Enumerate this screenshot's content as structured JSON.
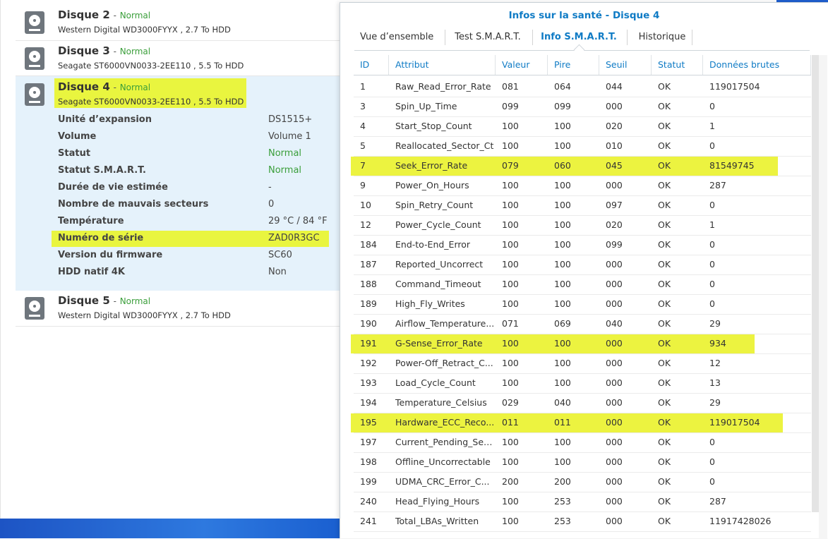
{
  "disks": [
    {
      "name": "Disque 2",
      "status": "Normal",
      "model": "Western Digital WD3000FYYX , 2.7 To HDD"
    },
    {
      "name": "Disque 3",
      "status": "Normal",
      "model": "Seagate ST6000VN0033-2EE110 , 5.5 To HDD"
    },
    {
      "name": "Disque 4",
      "status": "Normal",
      "model": "Seagate ST6000VN0033-2EE110 , 5.5 To HDD"
    },
    {
      "name": "Disque 5",
      "status": "Normal",
      "model": "Western Digital WD3000FYYX , 2.7 To HDD"
    }
  ],
  "separator": "-",
  "details": [
    {
      "label": "Unité d’expansion",
      "value": "DS1515+"
    },
    {
      "label": "Volume",
      "value": "Volume 1"
    },
    {
      "label": "Statut",
      "value": "Normal"
    },
    {
      "label": "Statut S.M.A.R.T.",
      "value": "Normal"
    },
    {
      "label": "Durée de vie estimée",
      "value": "-"
    },
    {
      "label": "Nombre de mauvais secteurs",
      "value": "0"
    },
    {
      "label": "Température",
      "value": "29 °C / 84 °F"
    },
    {
      "label": "Numéro de série",
      "value": "ZAD0R3GC"
    },
    {
      "label": "Version du firmware",
      "value": "SC60"
    },
    {
      "label": "HDD natif 4K",
      "value": "Non"
    }
  ],
  "dialog": {
    "title": "Infos sur la santé - Disque 4",
    "tabs": [
      "Vue d’ensemble",
      "Test S.M.A.R.T.",
      "Info S.M.A.R.T.",
      "Historique"
    ],
    "active_tab": "Info S.M.A.R.T."
  },
  "table": {
    "headers": [
      "ID",
      "Attribut",
      "Valeur",
      "Pire",
      "Seuil",
      "Statut",
      "Données brutes"
    ],
    "rows": [
      [
        "1",
        "Raw_Read_Error_Rate",
        "081",
        "064",
        "044",
        "OK",
        "119017504"
      ],
      [
        "3",
        "Spin_Up_Time",
        "099",
        "099",
        "000",
        "OK",
        "0"
      ],
      [
        "4",
        "Start_Stop_Count",
        "100",
        "100",
        "020",
        "OK",
        "1"
      ],
      [
        "5",
        "Reallocated_Sector_Ct",
        "100",
        "100",
        "010",
        "OK",
        "0"
      ],
      [
        "7",
        "Seek_Error_Rate",
        "079",
        "060",
        "045",
        "OK",
        "81549745"
      ],
      [
        "9",
        "Power_On_Hours",
        "100",
        "100",
        "000",
        "OK",
        "287"
      ],
      [
        "10",
        "Spin_Retry_Count",
        "100",
        "100",
        "097",
        "OK",
        "0"
      ],
      [
        "12",
        "Power_Cycle_Count",
        "100",
        "100",
        "020",
        "OK",
        "1"
      ],
      [
        "184",
        "End-to-End_Error",
        "100",
        "100",
        "099",
        "OK",
        "0"
      ],
      [
        "187",
        "Reported_Uncorrect",
        "100",
        "100",
        "000",
        "OK",
        "0"
      ],
      [
        "188",
        "Command_Timeout",
        "100",
        "100",
        "000",
        "OK",
        "0"
      ],
      [
        "189",
        "High_Fly_Writes",
        "100",
        "100",
        "000",
        "OK",
        "0"
      ],
      [
        "190",
        "Airflow_Temperature...",
        "071",
        "069",
        "040",
        "OK",
        "29"
      ],
      [
        "191",
        "G-Sense_Error_Rate",
        "100",
        "100",
        "000",
        "OK",
        "934"
      ],
      [
        "192",
        "Power-Off_Retract_C...",
        "100",
        "100",
        "000",
        "OK",
        "12"
      ],
      [
        "193",
        "Load_Cycle_Count",
        "100",
        "100",
        "000",
        "OK",
        "13"
      ],
      [
        "194",
        "Temperature_Celsius",
        "029",
        "040",
        "000",
        "OK",
        "29"
      ],
      [
        "195",
        "Hardware_ECC_Reco...",
        "011",
        "011",
        "000",
        "OK",
        "119017504"
      ],
      [
        "197",
        "Current_Pending_Sec...",
        "100",
        "100",
        "000",
        "OK",
        "0"
      ],
      [
        "198",
        "Offline_Uncorrectable",
        "100",
        "100",
        "000",
        "OK",
        "0"
      ],
      [
        "199",
        "UDMA_CRC_Error_C...",
        "200",
        "200",
        "000",
        "OK",
        "0"
      ],
      [
        "240",
        "Head_Flying_Hours",
        "100",
        "253",
        "000",
        "OK",
        "287"
      ],
      [
        "241",
        "Total_LBAs_Written",
        "100",
        "253",
        "000",
        "OK",
        "11917428026"
      ]
    ],
    "highlighted_ids": [
      "7",
      "191",
      "195"
    ]
  },
  "colors": {
    "highlight": "#e9f53f",
    "accent": "#0f7bc5",
    "ok_green": "#3a9e3a",
    "selected_row": "#e5f2fb"
  }
}
